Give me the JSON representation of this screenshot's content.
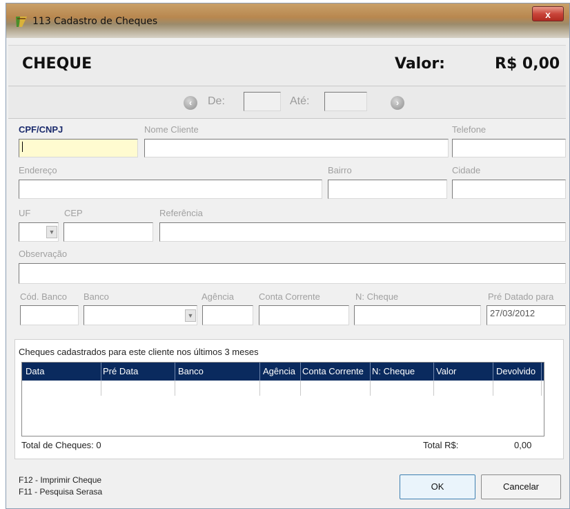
{
  "window": {
    "title": "113 Cadastro de Cheques",
    "close_label": "x"
  },
  "header": {
    "title": "CHEQUE",
    "valor_label": "Valor:",
    "valor_amount": "R$ 0,00"
  },
  "navigation": {
    "de_label": "De:",
    "ate_label": "Até:",
    "de_value": "",
    "ate_value": ""
  },
  "form": {
    "cpf_label": "CPF/CNPJ",
    "nome_label": "Nome Cliente",
    "telefone_label": "Telefone",
    "endereco_label": "Endereço",
    "bairro_label": "Bairro",
    "cidade_label": "Cidade",
    "uf_label": "UF",
    "cep_label": "CEP",
    "referencia_label": "Referência",
    "observacao_label": "Observação",
    "cod_banco_label": "Cód. Banco",
    "banco_label": "Banco",
    "agencia_label": "Agência",
    "conta_label": "Conta Corrente",
    "nro_cheque_label": "N: Cheque",
    "pre_datado_label": "Pré Datado para",
    "pre_datado_value": "27/03/2012"
  },
  "history": {
    "title": "Cheques cadastrados para este cliente nos últimos 3 meses",
    "columns": [
      "Data",
      "Pré Data",
      "Banco",
      "Agência",
      "Conta Corrente",
      "N: Cheque",
      "Valor",
      "Devolvido"
    ],
    "rows": [],
    "total_cheques_label": "Total de Cheques: 0",
    "total_rs_label": "Total R$:",
    "total_rs_value": "0,00"
  },
  "footer": {
    "hint1": "F12 - Imprimir Cheque",
    "hint2": "F11 - Pesquisa Serasa",
    "ok_label": "OK",
    "cancel_label": "Cancelar"
  },
  "colors": {
    "grid_header": "#0a2a5e",
    "cpf_highlight": "#fffbd0",
    "cpf_label": "#1a2a6c"
  }
}
